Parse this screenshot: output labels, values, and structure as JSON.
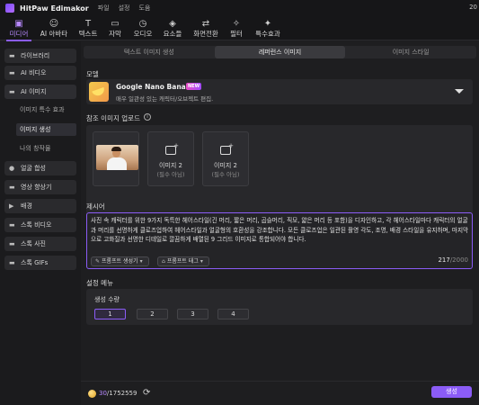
{
  "titlebar": {
    "app_name": "HitPaw Edimakor",
    "menus": [
      "파일",
      "설정",
      "도움"
    ],
    "right_text": "20"
  },
  "toolbar": {
    "tools": [
      {
        "label": "미디어",
        "icon": "media-icon",
        "active": true
      },
      {
        "label": "AI 아바타",
        "icon": "avatar-icon",
        "active": false
      },
      {
        "label": "텍스트",
        "icon": "text-icon",
        "active": false
      },
      {
        "label": "자막",
        "icon": "subtitle-icon",
        "active": false
      },
      {
        "label": "오디오",
        "icon": "audio-icon",
        "active": false
      },
      {
        "label": "요소들",
        "icon": "elements-icon",
        "active": false
      },
      {
        "label": "화면전환",
        "icon": "transition-icon",
        "active": false
      },
      {
        "label": "필터",
        "icon": "filter-icon",
        "active": false
      },
      {
        "label": "특수효과",
        "icon": "effects-icon",
        "active": false
      }
    ]
  },
  "sidebar": {
    "items": [
      {
        "label": "라이브러리",
        "icon": "folder-icon"
      },
      {
        "label": "AI 비디오",
        "icon": "folder-icon"
      },
      {
        "label": "AI 이미지",
        "icon": "folder-icon"
      },
      {
        "label": "얼굴 합성",
        "icon": "face-icon"
      },
      {
        "label": "영상 향상기",
        "icon": "folder-icon"
      },
      {
        "label": "배경",
        "icon": "play-icon"
      },
      {
        "label": "스톡 비디오",
        "icon": "folder-icon"
      },
      {
        "label": "스톡 사진",
        "icon": "folder-icon"
      },
      {
        "label": "스톡 GIFs",
        "icon": "folder-icon"
      }
    ],
    "subitems": [
      "이미지 특수 효과",
      "이미지 생성",
      "나의 창작물"
    ]
  },
  "main": {
    "tabs": [
      "텍스트 이미지 생성",
      "레퍼런스 이미지",
      "이미지 스타일"
    ],
    "active_tab": 1,
    "model_label": "모델",
    "model": {
      "name": "Google Nano Banana",
      "badge": "NEW",
      "description": "매우 일관성 있는 캐릭터/오브젝트 편집."
    },
    "ref_label": "참조 이미지 업로드",
    "slots": [
      {
        "title": "",
        "subtitle": ""
      },
      {
        "title": "이미지 2",
        "subtitle": "(필수 아님)"
      },
      {
        "title": "이미지 2",
        "subtitle": "(필수 아님)"
      }
    ],
    "prompt_label": "제시어",
    "prompt_text": "사진 속 캐릭터를 위한 9가지 독특한 헤어스타일(긴 머리, 짧은 머리, 곱슬머리, 직모, 얇은 머리 등 포함)을 디자인하고, 각 헤어스타일마다 캐릭터의 얼굴과 머리를 선명하게 클로즈업하여 헤어스타일과 얼굴형의 호환성을 강조합니다. 모든 클로즈업은 일관된 촬영 각도, 조명, 배경 스타일을 유지하며, 마지막으로 고화질과 선명한 디테일로 깔끔하게 배열된 9 그리드 이미지로 통합되어야 합니다.",
    "prompt_buttons": [
      "프롬프트 생성기",
      "프롬프트 태그"
    ],
    "char_count": "217",
    "char_max": "/2000",
    "settings_label": "설정 메뉴",
    "count_label": "생성 수량",
    "counts": [
      "1",
      "2",
      "3",
      "4"
    ],
    "selected_count": "1"
  },
  "footer": {
    "credits_used": "30",
    "credits_total": "/1752559",
    "generate_label": "생성"
  },
  "colors": {
    "accent": "#8b5cf6",
    "background": "#1e1e20"
  }
}
